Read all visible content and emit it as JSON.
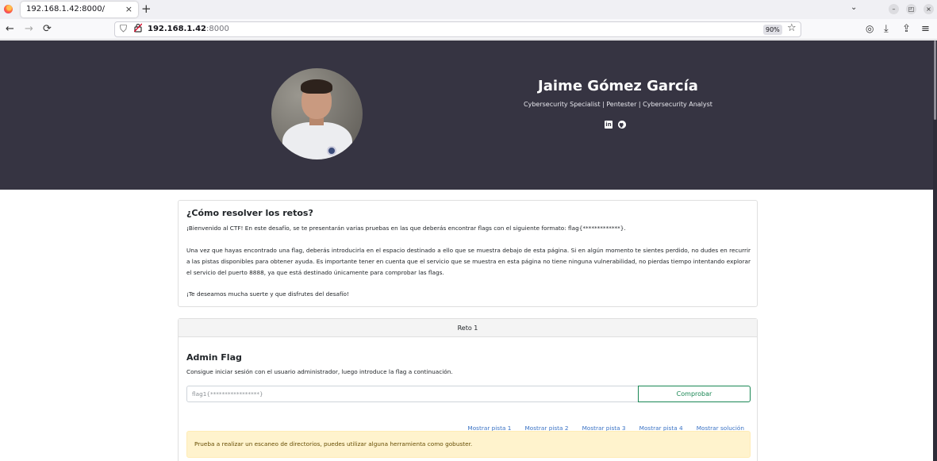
{
  "browser": {
    "tab_title": "192.168.1.42:8000/",
    "tab_close": "×",
    "new_tab": "+",
    "url_host": "192.168.1.42",
    "url_port": ":8000",
    "zoom": "90%",
    "icons": {
      "back": "←",
      "forward": "→",
      "reload": "⟳",
      "shield": "⛉",
      "lock": "🔒",
      "star": "☆",
      "pocket": "◎",
      "download": "⤓",
      "extensions": "⇪",
      "menu": "≡",
      "tab_list": "⌄",
      "minimize": "–",
      "maximize": "◰",
      "close": "×"
    }
  },
  "profile": {
    "name": "Jaime Gómez García",
    "subtitle": "Cybersecurity Specialist | Pentester | Cybersecurity Analyst",
    "social_icons": [
      "linkedin-icon",
      "github-icon"
    ]
  },
  "instructions": {
    "title": "¿Cómo resolver los retos?",
    "p1": "¡Bienvenido al CTF! En este desafío, se te presentarán varias pruebas en las que deberás encontrar flags con el siguiente formato: flag{*************}.",
    "p2": "Una vez que hayas encontrado una flag, deberás introducirla en el espacio destinado a ello que se muestra debajo de esta página. Si en algún momento te sientes perdido, no dudes en recurrir a las pistas disponibles para obtener ayuda. Es importante tener en cuenta que el servicio que se muestra en esta página no tiene ninguna vulnerabilidad, no pierdas tiempo intentando explorar el servicio del puerto 8888, ya que está destinado únicamente para comprobar las flags.",
    "p3": "¡Te deseamos mucha suerte y que disfrutes del desafío!"
  },
  "reto": {
    "header": "Reto 1",
    "title": "Admin Flag",
    "description": "Consigue iniciar sesión con el usuario administrador, luego introduce la flag a continuación.",
    "input_placeholder": "flag1{*****************}",
    "button_label": "Comprobar",
    "hints": [
      "Mostrar pista 1",
      "Mostrar pista 2",
      "Mostrar pista 3",
      "Mostrar pista 4",
      "Mostrar solución"
    ],
    "hint_text": "Prueba a realizar un escaneo de directorios, puedes utilizar alguna herramienta como gobuster."
  }
}
